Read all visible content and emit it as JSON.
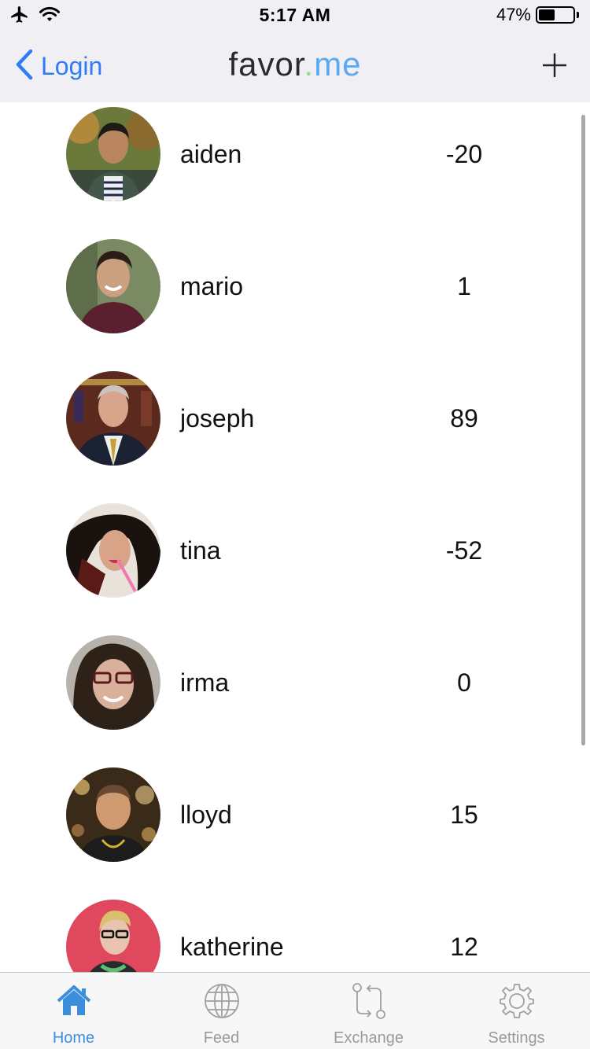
{
  "status_bar": {
    "time": "5:17 AM",
    "battery_percent": "47%",
    "battery_level": 0.47
  },
  "nav": {
    "back_label": "Login",
    "brand_part1": "favor",
    "brand_dot": ".",
    "brand_part2": "me"
  },
  "list": [
    {
      "name": "aiden",
      "value": "-20"
    },
    {
      "name": "mario",
      "value": "1"
    },
    {
      "name": "joseph",
      "value": "89"
    },
    {
      "name": "tina",
      "value": "-52"
    },
    {
      "name": "irma",
      "value": "0"
    },
    {
      "name": "lloyd",
      "value": "15"
    },
    {
      "name": "katherine",
      "value": "12"
    }
  ],
  "tabs": [
    {
      "label": "Home",
      "icon": "home-icon",
      "active": true
    },
    {
      "label": "Feed",
      "icon": "globe-icon",
      "active": false
    },
    {
      "label": "Exchange",
      "icon": "exchange-icon",
      "active": false
    },
    {
      "label": "Settings",
      "icon": "gear-icon",
      "active": false
    }
  ],
  "colors": {
    "accent": "#2f7cf6",
    "tab_active": "#3b8fdd",
    "tab_inactive": "#9a9a9a",
    "header_bg": "#efeff4"
  }
}
